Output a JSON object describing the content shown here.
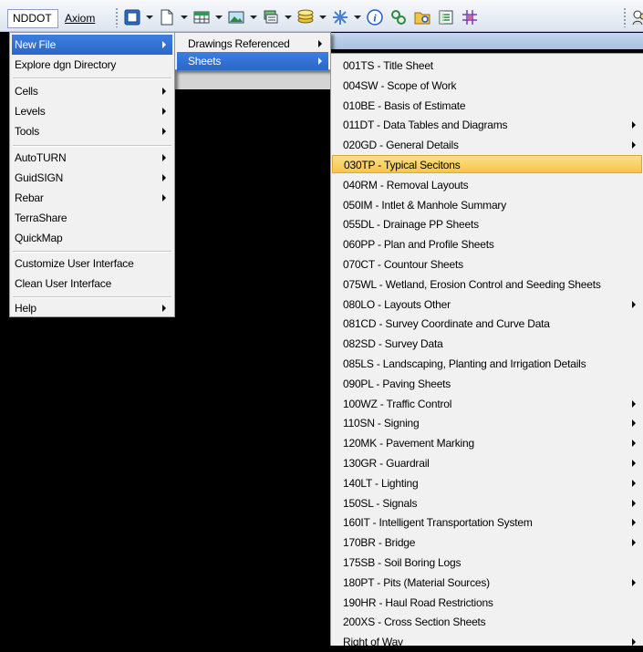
{
  "toolbar": {
    "menus": [
      "NDDOT",
      "Axiom"
    ],
    "icons": [
      "window-icon",
      "new-file-icon",
      "table-icon",
      "image-icon",
      "layers-icon",
      "level-icon",
      "star-icon",
      "info-icon",
      "search-icon",
      "folder-icon",
      "report-icon",
      "grid-icon",
      "people-icon"
    ]
  },
  "main_menu": {
    "items": [
      {
        "label": "New File",
        "submenu": true
      },
      {
        "label": "Explore dgn Directory",
        "submenu": false
      },
      {
        "label": "Cells",
        "submenu": true
      },
      {
        "label": "Levels",
        "submenu": true
      },
      {
        "label": "Tools",
        "submenu": true
      },
      {
        "label": "AutoTURN",
        "submenu": true
      },
      {
        "label": "GuidSIGN",
        "submenu": true
      },
      {
        "label": "Rebar",
        "submenu": true
      },
      {
        "label": "TerraShare",
        "submenu": false
      },
      {
        "label": "QuickMap",
        "submenu": false
      },
      {
        "label": "Customize User Interface",
        "submenu": false
      },
      {
        "label": "Clean User Interface",
        "submenu": false
      },
      {
        "label": "Help",
        "submenu": true
      }
    ]
  },
  "new_file_menu": {
    "items": [
      {
        "label": "Drawings Referenced",
        "submenu": true
      },
      {
        "label": "Sheets",
        "submenu": true
      }
    ]
  },
  "sheets_menu": {
    "items": [
      {
        "label": "001TS - Title Sheet",
        "submenu": false
      },
      {
        "label": "004SW - Scope of Work",
        "submenu": false
      },
      {
        "label": "010BE - Basis of Estimate",
        "submenu": false
      },
      {
        "label": "011DT - Data Tables and Diagrams",
        "submenu": true
      },
      {
        "label": "020GD - General Details",
        "submenu": true
      },
      {
        "label": "030TP - Typical Secitons",
        "submenu": false
      },
      {
        "label": "040RM - Removal Layouts",
        "submenu": false
      },
      {
        "label": "050IM - Intlet & Manhole Summary",
        "submenu": false
      },
      {
        "label": "055DL - Drainage PP Sheets",
        "submenu": false
      },
      {
        "label": "060PP - Plan and Profile Sheets",
        "submenu": false
      },
      {
        "label": "070CT - Countour Sheets",
        "submenu": false
      },
      {
        "label": "075WL - Wetland, Erosion Control and Seeding Sheets",
        "submenu": false
      },
      {
        "label": "080LO - Layouts Other",
        "submenu": true
      },
      {
        "label": "081CD - Survey Coordinate and Curve Data",
        "submenu": false
      },
      {
        "label": "082SD - Survey Data",
        "submenu": false
      },
      {
        "label": "085LS - Landscaping, Planting and Irrigation Details",
        "submenu": false
      },
      {
        "label": "090PL - Paving Sheets",
        "submenu": false
      },
      {
        "label": "100WZ - Traffic Control",
        "submenu": true
      },
      {
        "label": "110SN - Signing",
        "submenu": true
      },
      {
        "label": "120MK - Pavement Marking",
        "submenu": true
      },
      {
        "label": "130GR - Guardrail",
        "submenu": true
      },
      {
        "label": "140LT - Lighting",
        "submenu": true
      },
      {
        "label": "150SL - Signals",
        "submenu": true
      },
      {
        "label": "160IT - Intelligent Transportation System",
        "submenu": true
      },
      {
        "label": "170BR - Bridge",
        "submenu": true
      },
      {
        "label": "175SB - Soil Boring Logs",
        "submenu": false
      },
      {
        "label": "180PT - Pits (Material Sources)",
        "submenu": true
      },
      {
        "label": "190HR - Haul Road Restrictions",
        "submenu": false
      },
      {
        "label": "200XS - Cross Section Sheets",
        "submenu": false
      },
      {
        "label": "Right of Way",
        "submenu": true
      }
    ]
  },
  "colors": {
    "active_blue": "#3d7ee0",
    "hover_orange": "#f7c64a",
    "desktop_black": "#000000"
  }
}
